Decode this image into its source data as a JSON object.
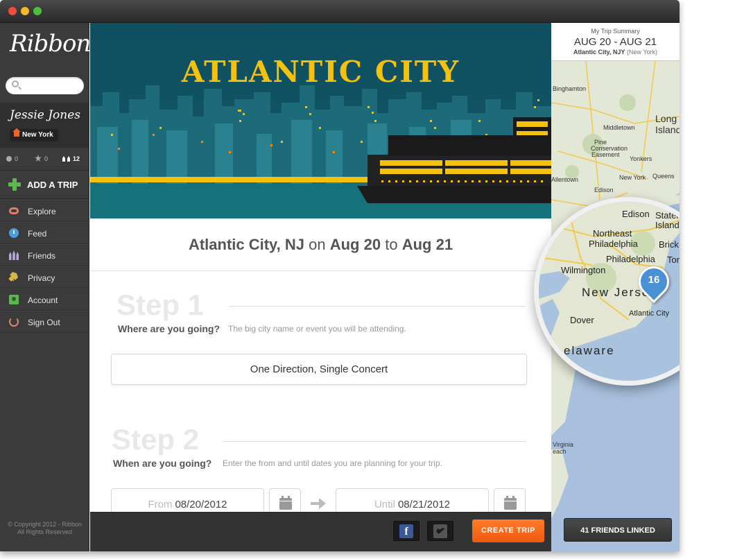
{
  "app": {
    "logo": "Ribbon",
    "copyright_line1": "© Copyright 2012 - Ribbon",
    "copyright_line2": "All Rights Reserved"
  },
  "search": {
    "placeholder": "",
    "value": ""
  },
  "user": {
    "name": "Jessie Jones",
    "location": "New York",
    "stats": {
      "comments": "0",
      "favorites": "0",
      "friends": "12"
    }
  },
  "sidebar": {
    "add_trip": "ADD A TRIP",
    "items": [
      {
        "label": "Explore",
        "icon": "eye-icon"
      },
      {
        "label": "Feed",
        "icon": "clock-icon"
      },
      {
        "label": "Friends",
        "icon": "friends-icon"
      },
      {
        "label": "Privacy",
        "icon": "key-icon"
      },
      {
        "label": "Account",
        "icon": "contact-card-icon"
      },
      {
        "label": "Sign Out",
        "icon": "sign-out-icon"
      }
    ]
  },
  "banner": {
    "title": "ATLANTIC CITY"
  },
  "destination": {
    "place": "Atlantic City, NJ",
    "on": "on",
    "from": "Aug 20",
    "to_word": "to",
    "until": "Aug 21"
  },
  "step1": {
    "title": "Step 1",
    "question": "Where are you going?",
    "hint": "The big city name or event you will be attending.",
    "value": "One Direction, Single Concert"
  },
  "step2": {
    "title": "Step 2",
    "question": "When are you going?",
    "hint": "Enter the from and until dates you are planning for your trip.",
    "from_label": "From",
    "from_value": "08/20/2012",
    "until_label": "Until",
    "until_value": "08/21/2012"
  },
  "footer": {
    "facebook": "f",
    "create_trip": "CREATE TRIP"
  },
  "summary": {
    "label": "My Trip Summary",
    "dates": "AUG 20 - AUG 21",
    "location": "Atlantic City, NJY",
    "location_extra": "(New York)",
    "friends_linked": "41 FRIENDS LINKED"
  },
  "map": {
    "labels": [
      "Binghamton",
      "Middletown",
      "Pine",
      "Conservation",
      "Easement",
      "Yonkers",
      "Allentown",
      "New York",
      "Queens",
      "Edison",
      "Long Island",
      "Virginia",
      "each"
    ],
    "magnifier": {
      "labels": [
        "Edison",
        "Staten",
        "Island",
        "Northeast",
        "Philadelphia",
        "Brick",
        "Philadelphia",
        "Toms River",
        "Wilmington",
        "New Jersey",
        "Dover",
        "Atlantic City",
        "elaware"
      ],
      "pin_count": "16"
    }
  },
  "colors": {
    "accent_orange": "#f0590e",
    "banner_teal": "#145865",
    "banner_gold": "#f4c20d",
    "sidebar_bg": "#3b3b3b",
    "add_green": "#5bb84c"
  }
}
